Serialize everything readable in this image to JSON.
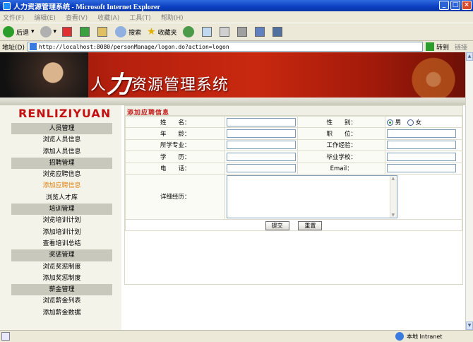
{
  "window": {
    "title": "人力资源管理系统 - Microsoft Internet Explorer",
    "buttons": {
      "minimize": "_",
      "maximize": "□",
      "close": "×"
    }
  },
  "menubar": [
    "文件(F)",
    "编辑(E)",
    "查看(V)",
    "收藏(A)",
    "工具(T)",
    "帮助(H)"
  ],
  "toolbar": {
    "back": "后退",
    "search": "搜索",
    "favorites": "收藏夹"
  },
  "address": {
    "label": "地址(D)",
    "url": "http://localhost:8080/personManage/logon.do?action=logon",
    "go": "转到",
    "links": "链接"
  },
  "banner": {
    "title_pre": "人",
    "title_big": "力",
    "title_post": "资源管理系统"
  },
  "logo": "RENLIZIYUAN",
  "sidebar": {
    "items": [
      {
        "label": "人员管理",
        "type": "header"
      },
      {
        "label": "浏览人员信息",
        "type": "link"
      },
      {
        "label": "添加人员信息",
        "type": "link"
      },
      {
        "label": "招聘管理",
        "type": "header"
      },
      {
        "label": "浏览应聘信息",
        "type": "link"
      },
      {
        "label": "添加应聘信息",
        "type": "active"
      },
      {
        "label": "浏览人才库",
        "type": "link"
      },
      {
        "label": "培训管理",
        "type": "header"
      },
      {
        "label": "浏览培训计划",
        "type": "link"
      },
      {
        "label": "添加培训计划",
        "type": "link"
      },
      {
        "label": "查看培训总结",
        "type": "link"
      },
      {
        "label": "奖惩管理",
        "type": "header"
      },
      {
        "label": "浏览奖惩制度",
        "type": "link"
      },
      {
        "label": "添加奖惩制度",
        "type": "link"
      },
      {
        "label": "薪金管理",
        "type": "header"
      },
      {
        "label": "浏览薪金列表",
        "type": "link"
      },
      {
        "label": "添加薪金数据",
        "type": "link"
      }
    ]
  },
  "form": {
    "title": "添加应聘信息",
    "rows": [
      {
        "left_label": "姓　　名：",
        "right_label": "性　　别："
      },
      {
        "left_label": "年　　龄：",
        "right_label": "职　　位："
      },
      {
        "left_label": "所学专业：",
        "right_label": "工作经验："
      },
      {
        "left_label": "学　　历：",
        "right_label": "毕业学校："
      },
      {
        "left_label": "电　　话：",
        "right_label": "Email："
      }
    ],
    "gender": {
      "male": "男",
      "female": "女",
      "selected": "男"
    },
    "resume_label": "详细经历：",
    "submit": "提交",
    "reset": "重置"
  },
  "status": {
    "zone": "本地 Intranet"
  },
  "colors": {
    "titlebar": "#0a3fc0",
    "banner": "#c8280f",
    "form_title": "#c41818",
    "active_link": "#e08010",
    "menu_header": "#c9c8bc"
  }
}
